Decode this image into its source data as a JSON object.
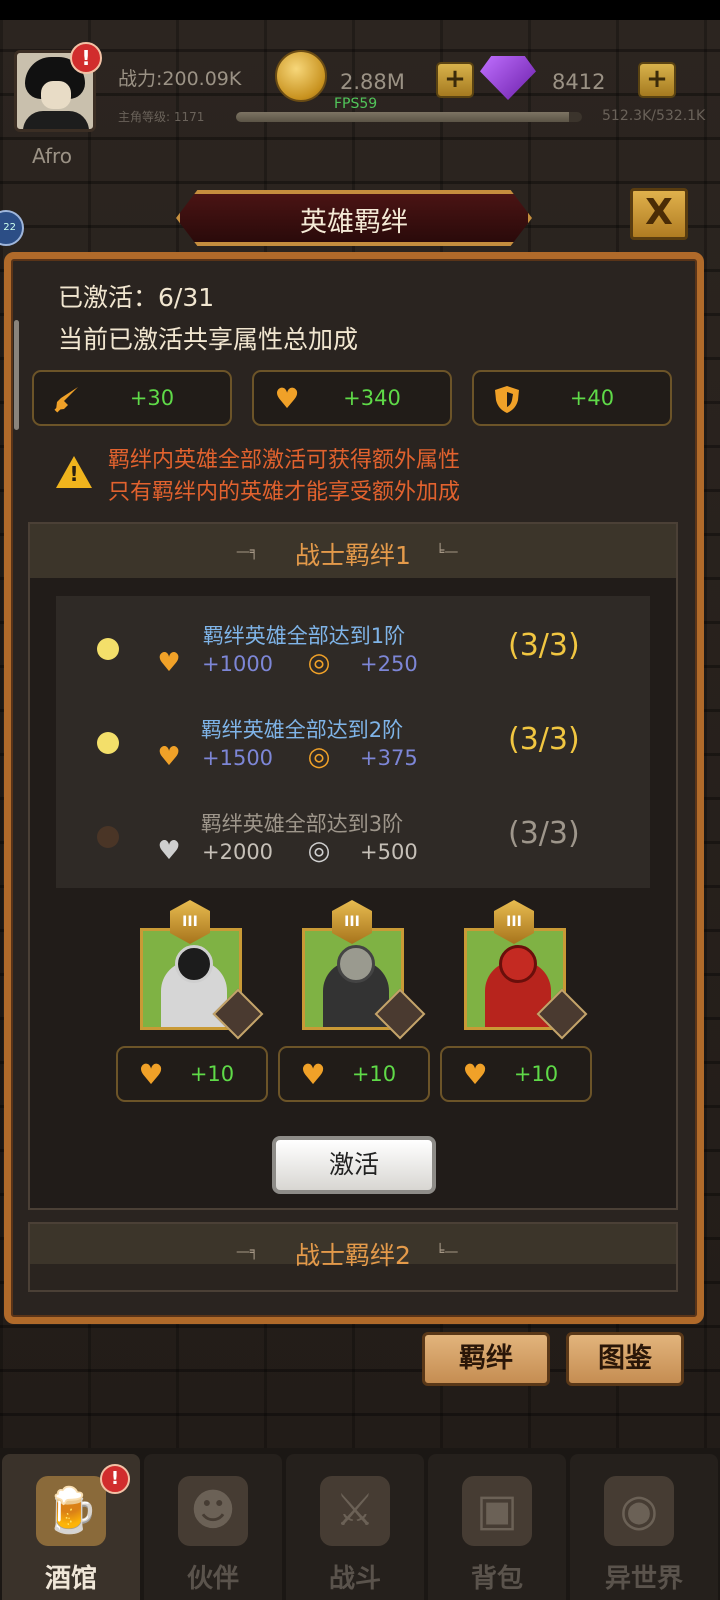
{
  "status": {
    "player_name": "Afro",
    "power": "战力:200.09K",
    "level_label": "主角等级: 1171",
    "exp_text": "512.3K/532.1K",
    "exp_fraction": 0.963,
    "gold": "2.88M",
    "gems": "8412",
    "fps": "FPS59",
    "plus": "+",
    "alert": "!",
    "side_badge": "22"
  },
  "dialog": {
    "title": "英雄羁绊",
    "close_label": "X",
    "activated": "已激活：6/31",
    "summary_title": "当前已激活共享属性总加成",
    "summary_stats": [
      {
        "icon": "sword-icon",
        "value": "+30"
      },
      {
        "icon": "heart-icon",
        "value": "+340"
      },
      {
        "icon": "shield-icon",
        "value": "+40"
      }
    ],
    "warning_lines": [
      "羁绊内英雄全部激活可获得额外属性",
      "只有羁绊内的英雄才能享受额外加成"
    ],
    "warning_mark": "!"
  },
  "bond1": {
    "title": "战士羁绊1",
    "deco_left": "—╕",
    "deco_right": "╘—",
    "rows": [
      {
        "title": "羁绊英雄全部达到1阶",
        "hp": "+1000",
        "crit": "+250",
        "count": "(3/3)",
        "active": true
      },
      {
        "title": "羁绊英雄全部达到2阶",
        "hp": "+1500",
        "crit": "+375",
        "count": "(3/3)",
        "active": true
      },
      {
        "title": "羁绊英雄全部达到3阶",
        "hp": "+2000",
        "crit": "+500",
        "count": "(3/3)",
        "active": false
      }
    ],
    "heroes": [
      {
        "rank": "III",
        "bonus": "+10"
      },
      {
        "rank": "III",
        "bonus": "+10"
      },
      {
        "rank": "III",
        "bonus": "+10"
      }
    ],
    "activate_label": "激活"
  },
  "bond2": {
    "title": "战士羁绊2"
  },
  "bottom_buttons": {
    "bond": "羁绊",
    "codex": "图鉴"
  },
  "tabs": [
    {
      "label": "酒馆",
      "icon": "tavern-mug-icon"
    },
    {
      "label": "伙伴",
      "icon": "partner-icon"
    },
    {
      "label": "战斗",
      "icon": "battle-swords-icon"
    },
    {
      "label": "背包",
      "icon": "backpack-icon"
    },
    {
      "label": "异世界",
      "icon": "portal-icon"
    }
  ],
  "colors": {
    "active_text": "#7fb4e8",
    "inactive_text": "#9e968b",
    "active_count": "#f1c641",
    "inactive_count": "#9e968b",
    "stat_value": "#5fda48",
    "warning": "#e2622e"
  }
}
